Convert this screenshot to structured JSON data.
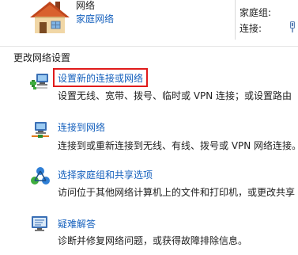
{
  "network": {
    "name": "网络",
    "type": "家庭网络",
    "homegroup_label": "家庭组:",
    "connection_label": "连接:"
  },
  "section": {
    "title": "更改网络设置"
  },
  "tasks": [
    {
      "link": "设置新的连接或网络",
      "desc": "设置无线、宽带、拨号、临时或 VPN 连接；或设置路由",
      "icon": "network-setup-icon",
      "highlighted": true
    },
    {
      "link": "连接到网络",
      "desc": "连接到或重新连接到无线、有线、拨号或 VPN 网络连接。",
      "icon": "connect-network-icon"
    },
    {
      "link": "选择家庭组和共享选项",
      "desc": "访问位于其他网络计算机上的文件和打印机，或更改共享",
      "icon": "homegroup-sharing-icon"
    },
    {
      "link": "疑难解答",
      "desc": "诊断并修复网络问题，或获得故障排除信息。",
      "icon": "troubleshoot-icon"
    }
  ],
  "colors": {
    "link": "#1560bd",
    "highlight_border": "#e01b1b",
    "text": "#1e1e1e"
  }
}
